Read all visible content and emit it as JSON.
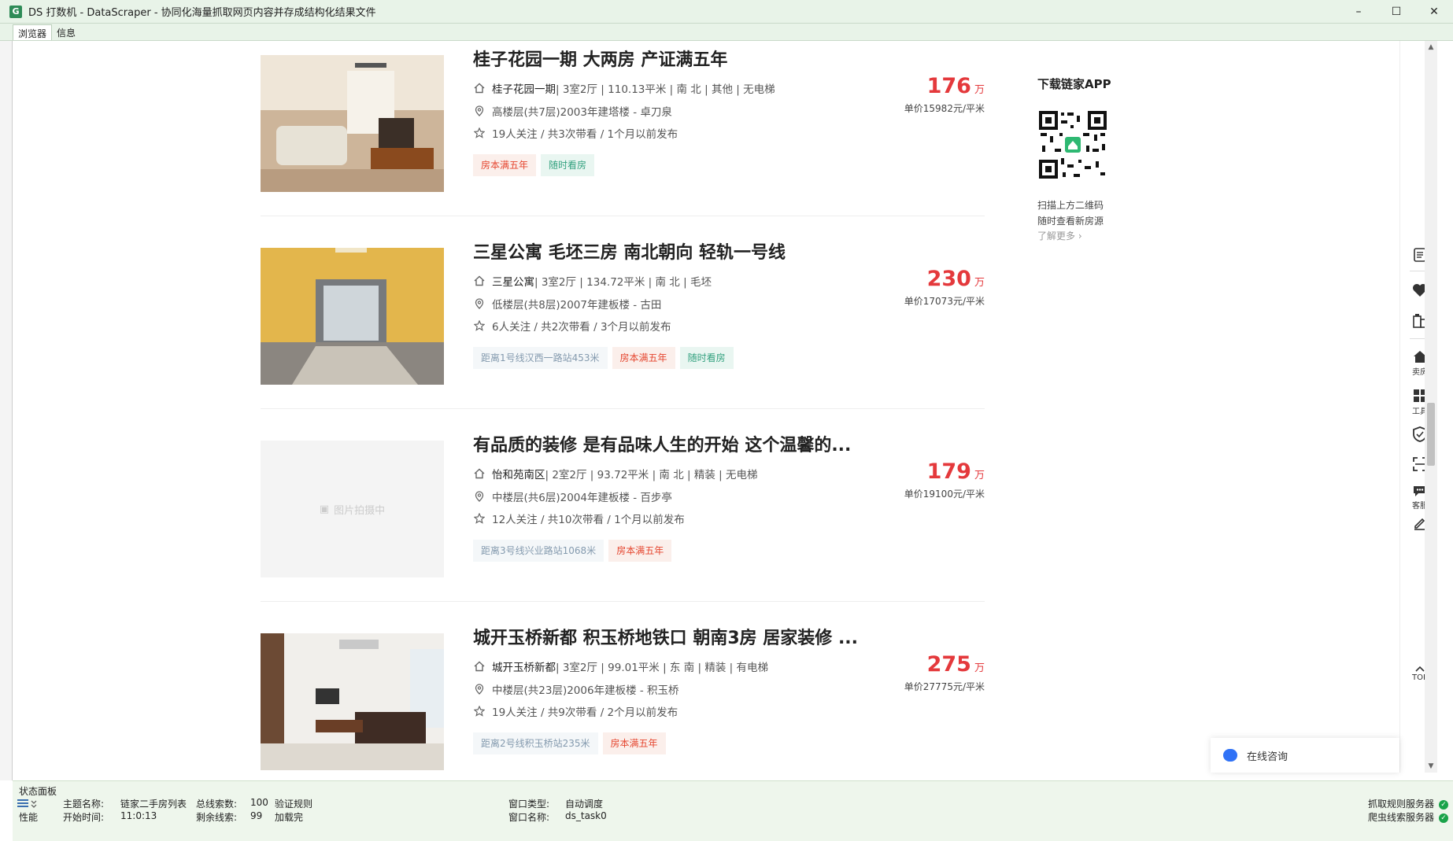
{
  "window": {
    "icon_letter": "G",
    "title": "DS 打数机 - DataScraper - 协同化海量抓取网页内容并存成结构化结果文件",
    "minimize": "–",
    "maximize": "☐",
    "close": "✕"
  },
  "tabs": [
    {
      "label": "浏览器",
      "active": true
    },
    {
      "label": "信息",
      "active": false
    }
  ],
  "listings": [
    {
      "title": "桂子花园一期 大两房 产证满五年",
      "community": "桂子花园一期",
      "house_info": " | 3室2厅 | 110.13平米 | 南 北 | 其他 | 无电梯",
      "position_info": "高楼层(共7层)2003年建塔楼 - 卓刀泉",
      "follow_info": "19人关注 / 共3次带看 / 1个月以前发布",
      "tags": [
        {
          "text": "房本满五年",
          "kind": "tax"
        },
        {
          "text": "随时看房",
          "kind": "visit"
        }
      ],
      "total_price": "176",
      "price_unit": "万",
      "unit_price": "单价15982元/平米",
      "photo": "living-room-photo"
    },
    {
      "title": "三星公寓 毛坯三房 南北朝向 轻轨一号线",
      "community": "三星公寓",
      "house_info": " | 3室2厅 | 134.72平米 | 南 北 | 毛坯",
      "position_info": "低楼层(共8层)2007年建板楼 - 古田",
      "follow_info": "6人关注 / 共2次带看 / 3个月以前发布",
      "tags": [
        {
          "text": "距离1号线汉西一路站453米",
          "kind": "sub"
        },
        {
          "text": "房本满五年",
          "kind": "tax"
        },
        {
          "text": "随时看房",
          "kind": "visit"
        }
      ],
      "total_price": "230",
      "price_unit": "万",
      "unit_price": "单价17073元/平米",
      "photo": "empty-room-photo"
    },
    {
      "title": "有品质的装修 是有品味人生的开始 这个温馨的...",
      "community": "怡和苑南区",
      "house_info": " | 2室2厅 | 93.72平米 | 南 北 | 精装 | 无电梯",
      "position_info": "中楼层(共6层)2004年建板楼 - 百步亭",
      "follow_info": "12人关注 / 共10次带看 / 1个月以前发布",
      "tags": [
        {
          "text": "距离3号线兴业路站1068米",
          "kind": "sub"
        },
        {
          "text": "房本满五年",
          "kind": "tax"
        }
      ],
      "total_price": "179",
      "price_unit": "万",
      "unit_price": "单价19100元/平米",
      "photo": "placeholder",
      "placeholder_text": "图片拍摄中"
    },
    {
      "title": "城开玉桥新都 积玉桥地铁口 朝南3房 居家装修 ...",
      "community": "城开玉桥新都",
      "house_info": " | 3室2厅 | 99.01平米 | 东 南 | 精装 | 有电梯",
      "position_info": "中楼层(共23层)2006年建板楼 - 积玉桥",
      "follow_info": "19人关注 / 共9次带看 / 2个月以前发布",
      "tags": [
        {
          "text": "距离2号线积玉桥站235米",
          "kind": "sub"
        },
        {
          "text": "房本满五年",
          "kind": "tax"
        }
      ],
      "total_price": "275",
      "price_unit": "万",
      "unit_price": "单价27775元/平米",
      "photo": "sofa-room-photo"
    }
  ],
  "app_promo": {
    "heading": "下载链家APP",
    "line1": "扫描上方二维码",
    "line2": "随时查看新房源",
    "more": "了解更多 ›"
  },
  "side_tools": [
    {
      "name": "list-icon",
      "label": ""
    },
    {
      "name": "heart-icon",
      "label": ""
    },
    {
      "name": "calculator-icon",
      "label": ""
    },
    {
      "name": "sell-house-icon",
      "label": "卖房"
    },
    {
      "name": "tools-icon",
      "label": "工具"
    },
    {
      "name": "shield-icon",
      "label": ""
    },
    {
      "name": "scan-icon",
      "label": ""
    },
    {
      "name": "service-icon",
      "label": "客服"
    },
    {
      "name": "edit-icon",
      "label": ""
    },
    {
      "name": "top-icon",
      "label": "TOP"
    }
  ],
  "chat": {
    "label": "在线咨询"
  },
  "status_panel": {
    "title": "状态面板",
    "perf_label": "性能",
    "theme_label": "主题名称:",
    "theme_value": "链家二手房列表",
    "total_label": "总线索数:",
    "total_value": "100",
    "verify_label": "验证规则",
    "start_label": "开始时间:",
    "start_value": "11:0:13",
    "remain_label": "剩余线索:",
    "remain_value": "99",
    "loaded_label": "加载完",
    "wintype_label": "窗口类型:",
    "wintype_value": "自动调度",
    "winname_label": "窗口名称:",
    "winname_value": "ds_task0",
    "server1": "抓取规则服务器",
    "server2": "爬虫线索服务器"
  }
}
